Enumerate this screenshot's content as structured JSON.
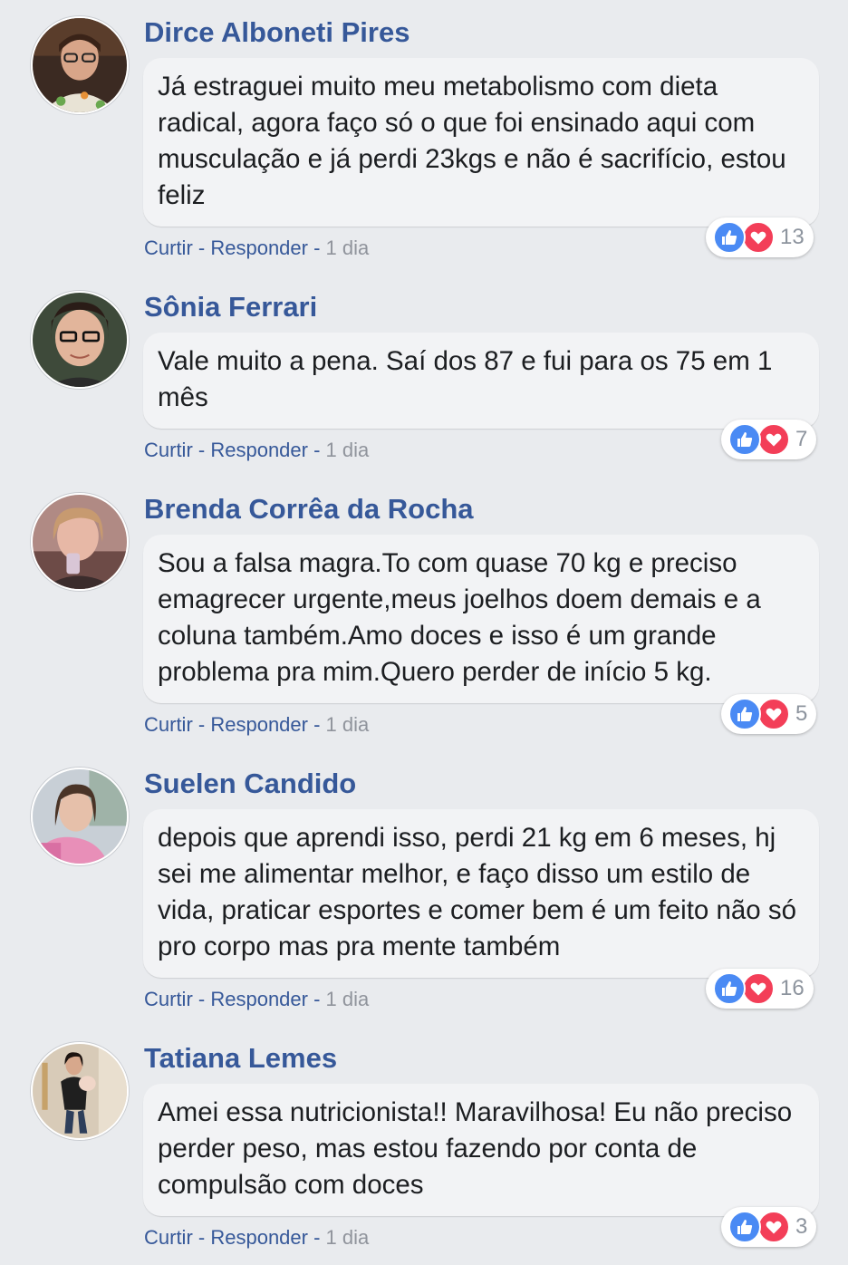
{
  "comments": [
    {
      "author": "Dirce Alboneti Pires",
      "text": "Já estraguei muito meu metabolismo com dieta radical, agora faço só o que foi ensinado aqui com musculação e já perdi 23kgs e não é sacrifício, estou feliz",
      "like_label": "Curtir",
      "sep1": " - ",
      "reply_label": "Responder",
      "sep2": " - ",
      "time": "1 dia",
      "reactions": [
        "like-icon",
        "love-icon"
      ],
      "reaction_count": "13"
    },
    {
      "author": "Sônia Ferrari",
      "text": "Vale muito a pena. Saí dos 87 e fui para os 75 em 1 mês",
      "like_label": "Curtir",
      "sep1": " - ",
      "reply_label": "Responder",
      "sep2": " - ",
      "time": "1 dia",
      "reactions": [
        "like-icon",
        "love-icon"
      ],
      "reaction_count": "7"
    },
    {
      "author": "Brenda Corrêa da Rocha",
      "text": "Sou a falsa magra.To com quase 70 kg e preciso emagrecer urgente,meus joelhos doem demais e a coluna também.Amo doces e isso é um grande problema pra mim.Quero perder de início 5 kg.",
      "like_label": "Curtir",
      "sep1": " - ",
      "reply_label": "Responder",
      "sep2": " - ",
      "time": "1 dia",
      "reactions": [
        "like-icon",
        "love-icon"
      ],
      "reaction_count": "5"
    },
    {
      "author": "Suelen Candido",
      "text": "depois que aprendi isso, perdi 21 kg em 6 meses, hj sei me alimentar melhor, e faço disso um estilo de vida, praticar esportes e comer bem é um feito não só pro corpo mas pra mente também",
      "like_label": "Curtir",
      "sep1": " - ",
      "reply_label": "Responder",
      "sep2": " - ",
      "time": "1 dia",
      "reactions": [
        "like-icon",
        "love-icon"
      ],
      "reaction_count": "16"
    },
    {
      "author": "Tatiana Lemes",
      "text": "Amei essa nutricionista!! Maravilhosa! Eu não preciso perder peso, mas estou fazendo por conta de compulsão com doces",
      "like_label": "Curtir",
      "sep1": " - ",
      "reply_label": "Responder",
      "sep2": " - ",
      "time": "1 dia",
      "reactions": [
        "like-icon",
        "love-icon"
      ],
      "reaction_count": "3"
    }
  ],
  "colors": {
    "background": "#e9ebee",
    "author": "#365899",
    "link": "#365899",
    "time": "#90949c",
    "bubble": "#f2f3f5",
    "like": "#4a8af4",
    "love": "#f33e58"
  }
}
